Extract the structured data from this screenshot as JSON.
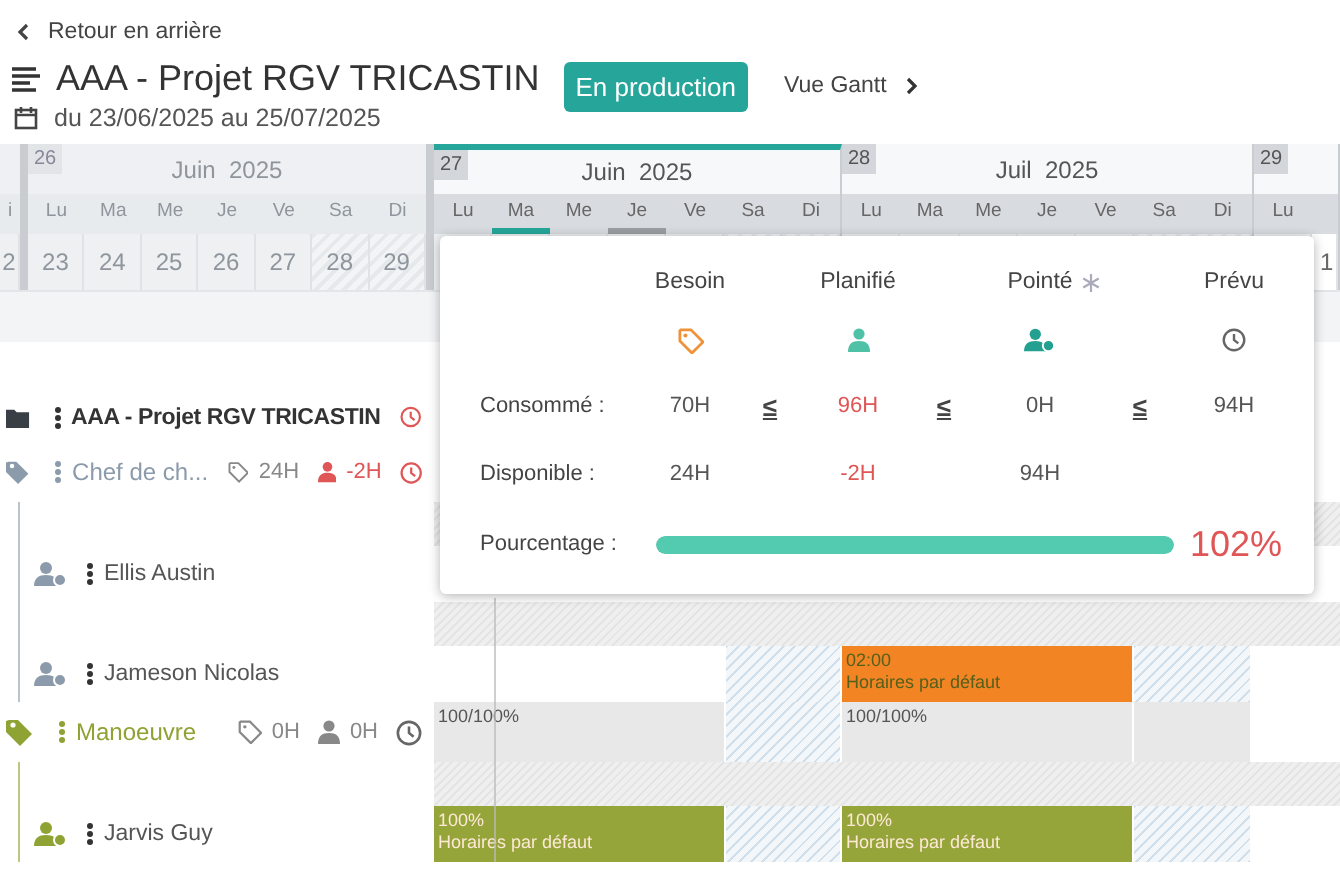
{
  "back_link": "Retour en arrière",
  "title": "AAA - Projet RGV TRICASTIN",
  "date_range": "du 23/06/2025 au 25/07/2025",
  "status_badge": "En production",
  "view_link": "Vue Gantt",
  "timeline": {
    "weeks": [
      {
        "dimmed": true,
        "selected": false,
        "days": [
          {
            "day": "i",
            "date": "2"
          }
        ]
      },
      {
        "number": "26",
        "month": "Juin  2025",
        "dimmed": true,
        "selected": false,
        "days": [
          {
            "day": "Lu",
            "date": "23"
          },
          {
            "day": "Ma",
            "date": "24"
          },
          {
            "day": "Me",
            "date": "25"
          },
          {
            "day": "Je",
            "date": "26"
          },
          {
            "day": "Ve",
            "date": "27"
          },
          {
            "day": "Sa",
            "date": "28"
          },
          {
            "day": "Di",
            "date": "29"
          }
        ]
      },
      {
        "number": "27",
        "month": "Juin  2025",
        "dimmed": false,
        "selected": true,
        "days": [
          {
            "day": "Lu",
            "today": false,
            "selected": false
          },
          {
            "day": "Ma",
            "today": true,
            "selected": false
          },
          {
            "day": "Me",
            "today": false,
            "selected": false
          },
          {
            "day": "Je",
            "today": false,
            "selected": true
          },
          {
            "day": "Ve",
            "today": false,
            "selected": false
          },
          {
            "day": "Sa",
            "today": false,
            "selected": false
          },
          {
            "day": "Di",
            "today": false,
            "selected": false
          }
        ]
      },
      {
        "number": "28",
        "month": "Juil  2025",
        "dimmed": false,
        "selected": false,
        "days": [
          {
            "day": "Lu"
          },
          {
            "day": "Ma"
          },
          {
            "day": "Me"
          },
          {
            "day": "Je"
          },
          {
            "day": "Ve"
          },
          {
            "day": "Sa"
          },
          {
            "day": "Di"
          }
        ]
      },
      {
        "number": "29",
        "dimmed": false,
        "selected": false,
        "days": [
          {
            "day": "Lu"
          },
          {
            "date": "1"
          }
        ]
      }
    ]
  },
  "tree": [
    {
      "kind": "project",
      "label": "AAA - Projet RGV TRICASTIN",
      "alert": true,
      "children": [
        {
          "kind": "role",
          "label": "Chef de ch...",
          "color": "#8c9bab",
          "need": "24H",
          "planned": "-2H",
          "alert": true,
          "children": [
            {
              "kind": "person",
              "label": "Ellis Austin"
            },
            {
              "kind": "person",
              "label": "Jameson Nicolas",
              "segments": [
                {
                  "kind": "empty"
                },
                {
                  "kind": "hatch"
                },
                {
                  "kind": "bar",
                  "color": "#f28423",
                  "lines": [
                    "02:00",
                    "Horaires par défaut"
                  ]
                },
                {
                  "kind": "hatch"
                }
              ]
            }
          ]
        },
        {
          "kind": "role",
          "label": "Manoeuvre",
          "color": "#8fa234",
          "need": "0H",
          "planned": "0H",
          "alert": false,
          "segments": [
            {
              "kind": "cell",
              "lines": [
                "100/100%"
              ]
            },
            {
              "kind": "hatch"
            },
            {
              "kind": "cell",
              "lines": [
                "100/100%"
              ]
            },
            {
              "kind": "cell"
            }
          ],
          "children": [
            {
              "kind": "person",
              "label": "Jarvis Guy",
              "segments": [
                {
                  "kind": "bar",
                  "color": "#95a53a",
                  "lines": [
                    "100%",
                    "Horaires par défaut"
                  ]
                },
                {
                  "kind": "hatch"
                },
                {
                  "kind": "bar",
                  "color": "#95a53a",
                  "lines": [
                    "100%",
                    "Horaires par défaut"
                  ]
                },
                {
                  "kind": "hatch"
                }
              ]
            }
          ]
        }
      ]
    }
  ],
  "popup": {
    "columns": [
      {
        "label": "Besoin",
        "frozen": false
      },
      {
        "label": "Planifié",
        "frozen": false
      },
      {
        "label": "Pointé",
        "frozen": true
      },
      {
        "label": "Prévu",
        "frozen": false
      }
    ],
    "rows": [
      {
        "label": "Consommé :",
        "cells": [
          {
            "text": "70H",
            "alert": false
          },
          {
            "text": "96H",
            "alert": true
          },
          {
            "text": "0H",
            "alert": false
          },
          {
            "text": "94H",
            "alert": false
          }
        ],
        "operators": [
          "≤",
          "≤",
          "≤"
        ]
      },
      {
        "label": "Disponible :",
        "cells": [
          {
            "text": "24H",
            "alert": false
          },
          {
            "text": "-2H",
            "alert": true
          },
          {
            "text": "94H",
            "alert": false
          }
        ]
      }
    ],
    "progress": {
      "label": "Pourcentage :",
      "level": 1,
      "reading": "102%",
      "over": true
    }
  }
}
